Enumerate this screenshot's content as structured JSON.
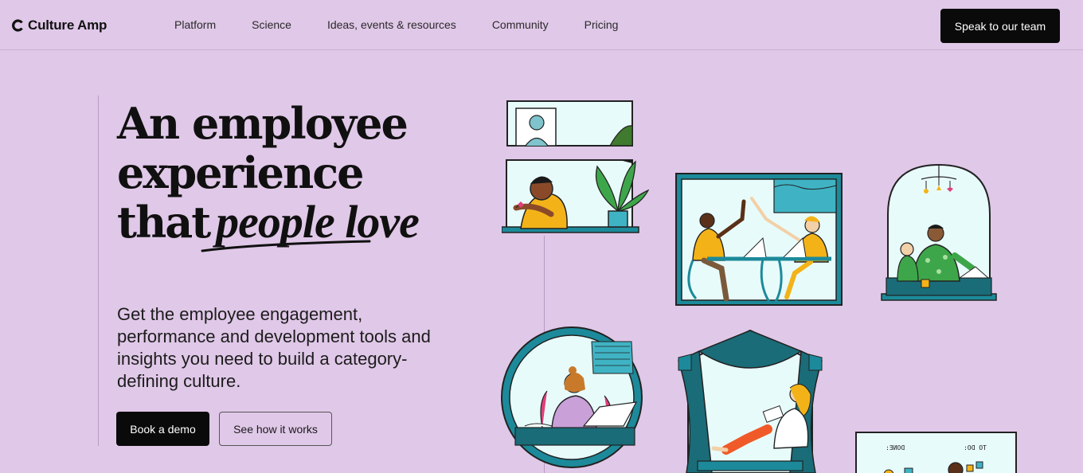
{
  "brand": {
    "name": "Culture Amp"
  },
  "nav": {
    "items": [
      {
        "label": "Platform"
      },
      {
        "label": "Science"
      },
      {
        "label": "Ideas, events & resources"
      },
      {
        "label": "Community"
      },
      {
        "label": "Pricing"
      }
    ],
    "cta_label": "Speak to our team"
  },
  "hero": {
    "headline_line1": "An employee",
    "headline_line2": "experience",
    "headline_line3_prefix": "that",
    "headline_script": "people love",
    "subcopy": "Get the employee engagement, performance and development tools and insights you need to build a category-defining culture.",
    "primary_label": "Book a demo",
    "secondary_label": "See how it works"
  },
  "illustrations": {
    "todo_label": "TO DO:",
    "done_label": "DONE:"
  },
  "colors": {
    "background": "#e0c8e8",
    "button_dark": "#0a0a0a",
    "teal": "#1c8a9a",
    "window_fill": "#e8fbfb",
    "yellow": "#f3b318",
    "green": "#3ea64a",
    "pink": "#e0407a"
  }
}
